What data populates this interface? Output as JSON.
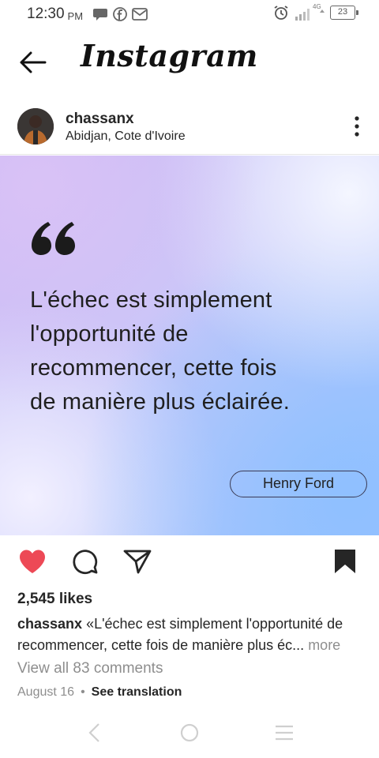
{
  "status_bar": {
    "time": "12:30",
    "ampm": "PM",
    "network": "4G",
    "battery": "23"
  },
  "header": {
    "brand": "Instagram",
    "icons": {
      "back": "arrow-left-icon"
    }
  },
  "post": {
    "username": "chassanx",
    "location": "Abidjan, Cote d'Ivoire",
    "quote_lines": [
      "L'échec est simplement",
      "l'opportunité de",
      "recommencer, cette fois",
      "de manière plus éclairée."
    ],
    "author": "Henry Ford",
    "likes": "2,545 likes",
    "caption_user": "chassanx",
    "caption_text": "«L'échec est simplement l'opportunité de recommencer, cette fois de manière plus éc...",
    "caption_more": "more",
    "view_comments": "View all 83 comments",
    "date": "August 16",
    "see_translation": "See translation"
  },
  "colors": {
    "like": "#ed4956",
    "text": "#262626",
    "muted": "#8e8e8e"
  }
}
